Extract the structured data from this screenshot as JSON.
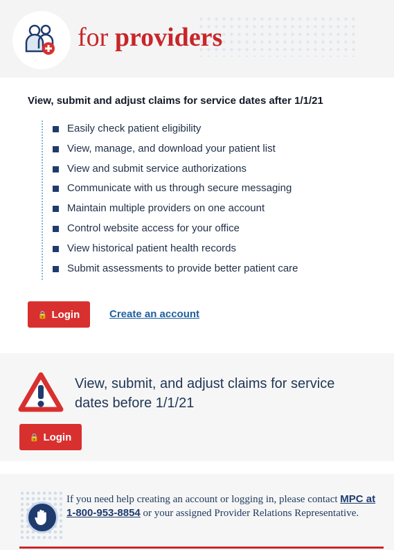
{
  "brand": {
    "word_for": "for",
    "word_providers": "providers"
  },
  "section1": {
    "headline": "View, submit and adjust claims for service dates after 1/1/21",
    "features": [
      "Easily check patient eligibility",
      "View, manage, and download your patient list",
      "View and submit service authorizations",
      "Communicate with us through secure messaging",
      "Maintain multiple providers on one account",
      "Control website access for your office",
      "View historical patient health records",
      "Submit assessments to provide better patient care"
    ],
    "login_label": "Login",
    "create_account_label": "Create an account"
  },
  "section2": {
    "text": "View, submit, and adjust claims for service dates before 1/1/21",
    "login_label": "Login"
  },
  "help": {
    "text_before": "If you need help creating an account or logging in, please contact ",
    "phone_link": "MPC at 1-800-953-8854",
    "text_after": " or your assigned Provider Relations Representative."
  },
  "colors": {
    "accent_red": "#c8262a",
    "navy": "#1f3b6e",
    "link_blue": "#1f5f9e"
  },
  "icons": [
    "doctors-badge-icon",
    "lock-icon",
    "warning-triangle-icon",
    "hand-stop-icon"
  ]
}
